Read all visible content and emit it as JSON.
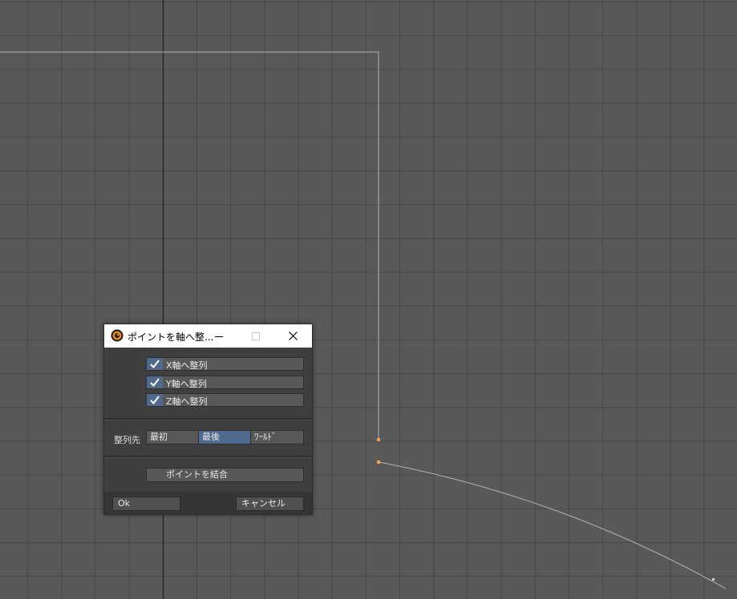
{
  "dialog": {
    "title": "ポイントを軸へ整...",
    "app_icon": "lightwave-logo-icon",
    "window_buttons": {
      "minimize": "minimize-icon",
      "maximize": "maximize-icon",
      "close": "close-icon"
    },
    "checkboxes": [
      {
        "label": "X軸へ整列",
        "checked": true
      },
      {
        "label": "Y軸へ整列",
        "checked": true
      },
      {
        "label": "Z軸へ整列",
        "checked": true
      }
    ],
    "align_to": {
      "label": "整列先",
      "options": [
        "最初",
        "最後",
        "ﾜｰﾙﾄﾞ"
      ],
      "selected": "最後"
    },
    "merge_points_label": "ポイントを結合",
    "ok_label": "Ok",
    "cancel_label": "キャンセル"
  },
  "colors": {
    "viewport_bg": "#595959",
    "grid_line": "#474747",
    "axis_line": "#1e1e1e",
    "curve": "#b4b4b4",
    "selected_point": "#f0a050",
    "accent": "#4f6a8c"
  }
}
